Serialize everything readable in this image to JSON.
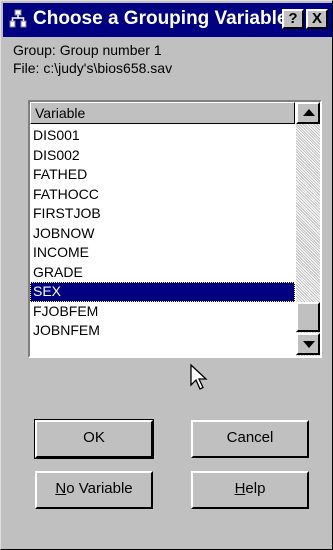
{
  "window": {
    "title": "Choose a Grouping Variable",
    "help_glyph": "?",
    "close_glyph": "X",
    "icon": "app-icon"
  },
  "info": {
    "group": "Group: Group number 1",
    "file": "File: c:\\judy's\\bios658.sav"
  },
  "list": {
    "header": "Variable",
    "items": [
      "DIS001",
      "DIS002",
      "FATHED",
      "FATHOCC",
      "FIRSTJOB",
      "JOBNOW",
      "INCOME",
      "GRADE",
      "SEX",
      "FJOBFEM",
      "JOBNFEM"
    ],
    "selected": "SEX"
  },
  "buttons": {
    "ok": "OK",
    "cancel": "Cancel",
    "no_variable_mnemonic": "N",
    "no_variable_rest": "o Variable",
    "help_mnemonic": "H",
    "help_rest": "elp"
  },
  "colors": {
    "titlebar": "#000080",
    "face": "#c0c0c0",
    "selection": "#000080"
  }
}
